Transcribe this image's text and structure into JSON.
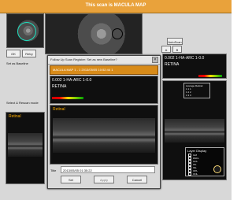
{
  "window": {
    "title": "This scan is MACULA MAP"
  },
  "left_panel": {
    "ok_label": "OK",
    "retry_label": "Retry",
    "set_as_baseline_label": "Set as Baseline",
    "select_rescan_label": "Select & Rescan mode",
    "retina_label": "Retinal"
  },
  "top_right": {
    "scan_label": "AutoScan",
    "btn1": "A",
    "btn2": "B"
  },
  "metrics": {
    "text": "0.002 1-HA-ARC 1-0.0",
    "status": "RETINA"
  },
  "dialog": {
    "title": "Follow Up Scan Register: Set as new Baseline?",
    "header": "MACULA MAP 1 - 1 2013/05/05 10:52:44 1",
    "retinal_label": "Retinal",
    "title_label": "Title",
    "title_value": "2013/05/05 01:35:22",
    "ok_label": "Set",
    "cancel_label": "Cancel",
    "apply_label": "Apply"
  },
  "right_panel": {
    "legend_title": "Average Retinal",
    "legend_items": [
      "1 1 1",
      "1 2 2",
      "1 3 3"
    ],
    "display_title": "Layer Display",
    "display_items": [
      "ILM",
      "RNFL",
      "GCL",
      "IPL",
      "INL",
      "OPL",
      "ONL"
    ],
    "gear_label": ""
  },
  "colors": {
    "accent": "#e9a23b",
    "orange_text": "#ffae00",
    "yellow_text": "#ffd800"
  }
}
